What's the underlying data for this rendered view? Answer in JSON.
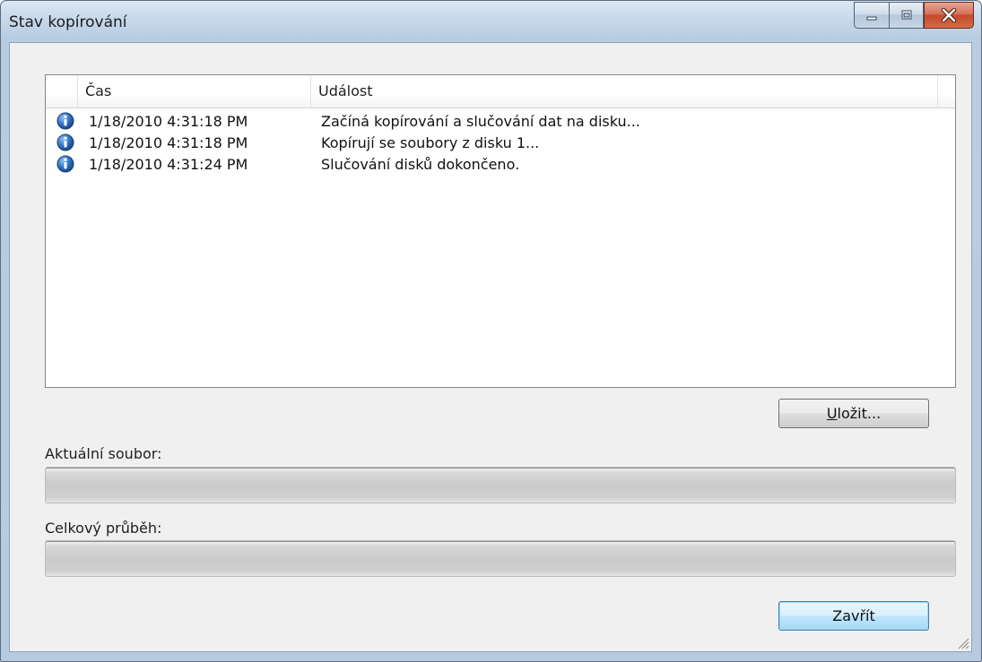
{
  "window": {
    "title": "Stav kopírování",
    "controls": {
      "minimize": "minimize-icon",
      "maximize": "maximize-icon",
      "close": "close-icon"
    }
  },
  "list": {
    "columns": [
      "Čas",
      "Událost"
    ],
    "rows": [
      {
        "icon": "info-icon",
        "time": "1/18/2010 4:31:18 PM",
        "event": "Začíná kopírování a slučování dat na disku..."
      },
      {
        "icon": "info-icon",
        "time": "1/18/2010 4:31:18 PM",
        "event": "Kopírují se soubory z disku 1..."
      },
      {
        "icon": "info-icon",
        "time": "1/18/2010 4:31:24 PM",
        "event": "Slučování disků dokončeno."
      }
    ]
  },
  "buttons": {
    "save": {
      "mnemonic": "U",
      "rest": "ložit..."
    },
    "close": "Zavřít"
  },
  "progress": {
    "current_file_label": "Aktuální soubor:",
    "current_file_value": 0,
    "overall_label": "Celkový průběh:",
    "overall_value": 0
  },
  "colors": {
    "info_icon": "#2e6fc0",
    "close_button": "#c44a2e",
    "default_button_border": "#3c7fb1"
  }
}
